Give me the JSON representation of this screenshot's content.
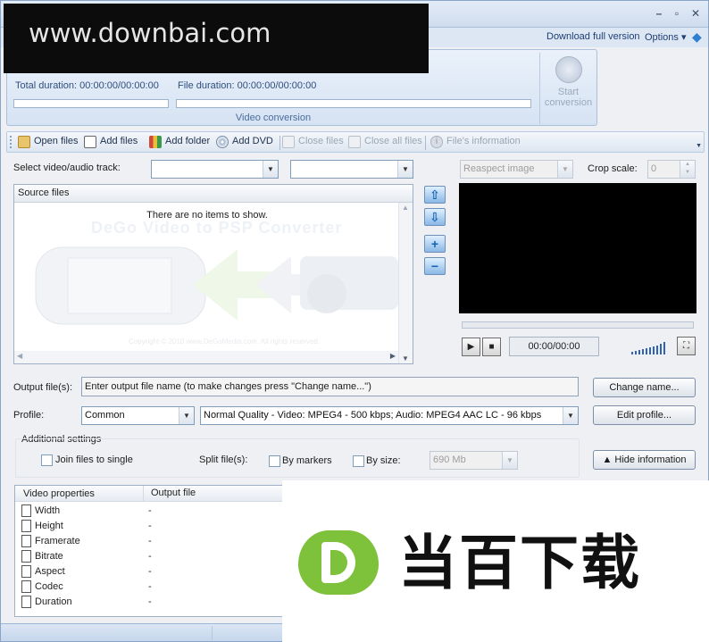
{
  "watermark": "www.downbai.com",
  "menubar": {
    "download": "Download full version",
    "options": "Options ▾"
  },
  "conversion": {
    "total_label": "Total duration: 00:00:00/00:00:00",
    "file_label": "File duration: 00:00:00/00:00:00",
    "caption": "Video conversion",
    "start_label_1": "Start",
    "start_label_2": "conversion",
    "total_progress": 0,
    "file_progress": 0
  },
  "toolbar": {
    "open": "Open files",
    "add": "Add files",
    "folder": "Add folder",
    "dvd": "Add DVD",
    "close": "Close files",
    "close_all": "Close all files",
    "info": "File's information"
  },
  "track": {
    "label": "Select video/audio track:",
    "video": "",
    "audio": ""
  },
  "source": {
    "header": "Source files",
    "empty": "There are no items to show.",
    "ghost": "DeGo Video to PSP Converter",
    "copyright": "Copyright © 2010 www.DeGoMedia.com. All rights reserved."
  },
  "preview": {
    "aspect": "Reaspect image",
    "crop_label": "Crop scale:",
    "crop_value": "0",
    "time": "00:00/00:00"
  },
  "output": {
    "label": "Output file(s):",
    "value": "Enter output file name (to make changes press \"Change name...\")",
    "change_button": "Change name..."
  },
  "profile": {
    "label": "Profile:",
    "category": "Common",
    "preset": "Normal Quality - Video: MPEG4 - 500 kbps; Audio: MPEG4 AAC LC - 96 kbps",
    "edit_button": "Edit profile..."
  },
  "additional": {
    "title": "Additional settings",
    "join": "Join files to single",
    "split_label": "Split file(s):",
    "by_markers": "By markers",
    "by_size": "By size:",
    "size_value": "690 Mb",
    "hide_button": "▲ Hide information"
  },
  "props": {
    "col1": "Video properties",
    "col2": "Output file",
    "rows": [
      {
        "k": "Width",
        "v": "-"
      },
      {
        "k": "Height",
        "v": "-"
      },
      {
        "k": "Framerate",
        "v": "-"
      },
      {
        "k": "Bitrate",
        "v": "-"
      },
      {
        "k": "Aspect",
        "v": "-"
      },
      {
        "k": "Codec",
        "v": "-"
      },
      {
        "k": "Duration",
        "v": "-"
      }
    ]
  },
  "logo": {
    "text": "当百下载"
  }
}
